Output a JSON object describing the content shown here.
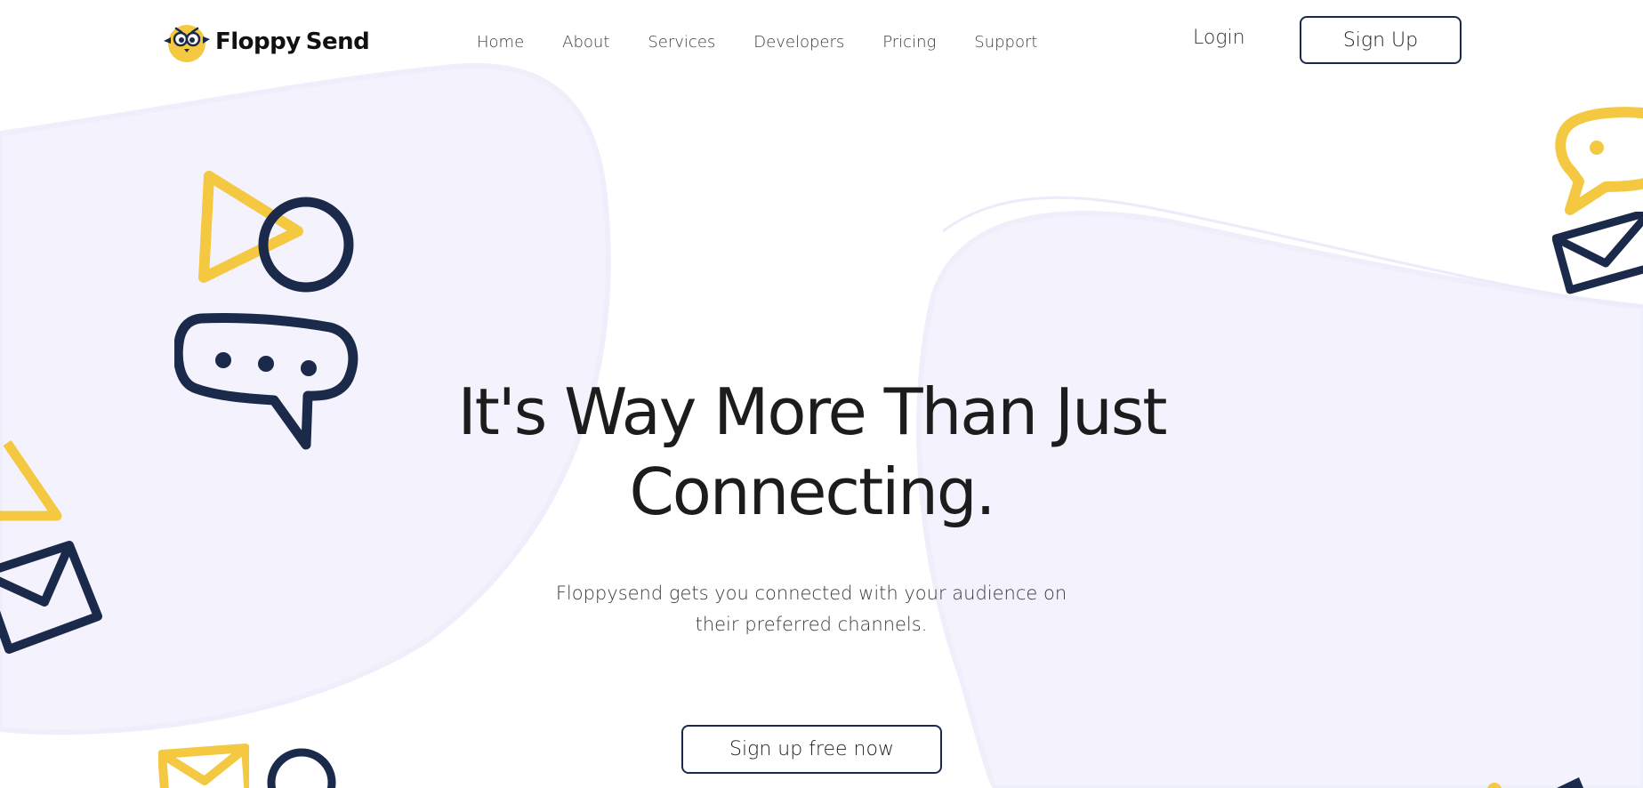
{
  "brand": {
    "name_part1": "Floppy",
    "name_part2": "Send",
    "logo_icon": "owl-mascot-icon"
  },
  "nav": {
    "items": [
      {
        "label": "Home"
      },
      {
        "label": "About"
      },
      {
        "label": "Services"
      },
      {
        "label": "Developers"
      },
      {
        "label": "Pricing"
      },
      {
        "label": "Support"
      }
    ],
    "login_label": "Login",
    "signup_label": "Sign Up"
  },
  "hero": {
    "title_line1": "It's Way More Than Just",
    "title_line2": "Connecting.",
    "subtitle_line1": "Floppysend gets you connected with your audience on",
    "subtitle_line2": "their preferred channels.",
    "cta_label": "Sign up free now"
  },
  "colors": {
    "accent_yellow": "#F5C842",
    "navy": "#1B2A4A",
    "blob": "#F4F3FD",
    "text": "#1C1C1C"
  },
  "decorations": [
    "play-triangle-icon",
    "circle-icon",
    "chat-bubble-icon",
    "envelope-icon"
  ]
}
